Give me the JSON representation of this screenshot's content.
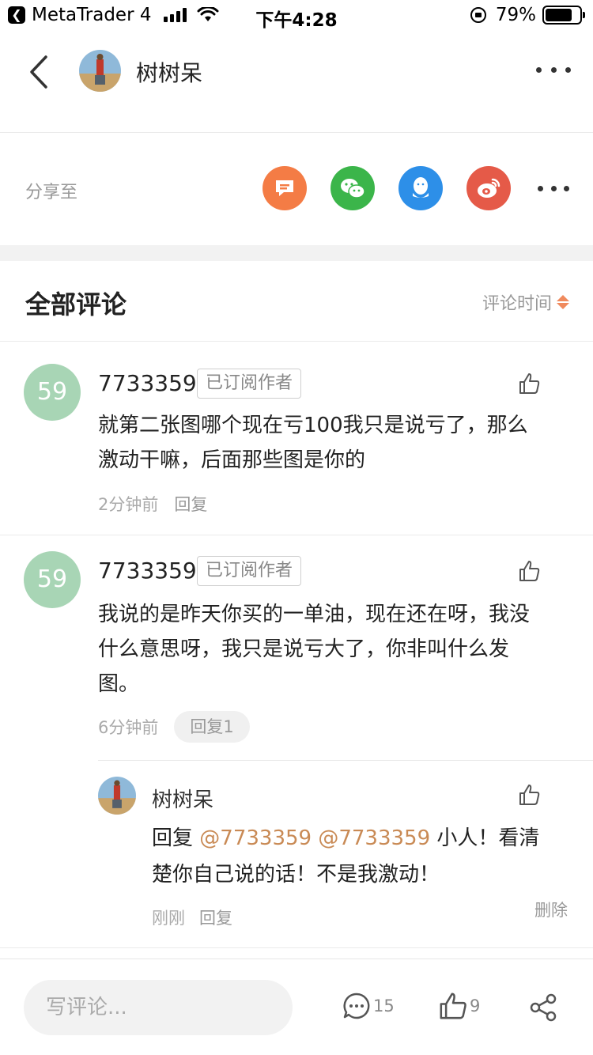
{
  "status_bar": {
    "back_app": "MetaTrader 4",
    "time": "下午4:28",
    "battery": "79%",
    "battery_level": 0.79
  },
  "nav": {
    "title": "树树呆",
    "back_icon": "chevron-left-icon",
    "more_icon": "more-icon"
  },
  "share": {
    "label": "分享至",
    "targets": [
      {
        "icon": "message-icon",
        "color": "#f47c45"
      },
      {
        "icon": "wechat-icon",
        "color": "#3bb54a"
      },
      {
        "icon": "qq-icon",
        "color": "#2d8fe8"
      },
      {
        "icon": "weibo-icon",
        "color": "#e55a48"
      }
    ]
  },
  "section": {
    "title": "全部评论",
    "sort_label": "评论时间"
  },
  "comments": [
    {
      "avatar_text": "59",
      "user": "7733359",
      "badge": "已订阅作者",
      "line1": "就第二张图哪个现在亏100我只是说亏了，那么",
      "line2": "激动干嘛，后面那些图是你的",
      "time": "2分钟前",
      "reply": "回复"
    },
    {
      "avatar_text": "59",
      "user": "7733359",
      "badge": "已订阅作者",
      "line1": "我说的是昨天你买的一单油，现在还在呀，我没",
      "line2": "什么意思呀，我只是说亏大了，你非叫什么发",
      "line3": "图。",
      "time": "6分钟前",
      "reply": "回复1",
      "sub_reply": {
        "user": "树树呆",
        "prefix": "回复",
        "mention1": "@7733359",
        "mention2": "@7733359",
        "line1_rest": "小人！看清",
        "line2": "楚你自己说的话！不是我激动！",
        "time": "刚刚",
        "reply": "回复",
        "delete": "删除"
      }
    }
  ],
  "bottom": {
    "placeholder": "写评论...",
    "comment_count": "15",
    "like_count": "9"
  }
}
